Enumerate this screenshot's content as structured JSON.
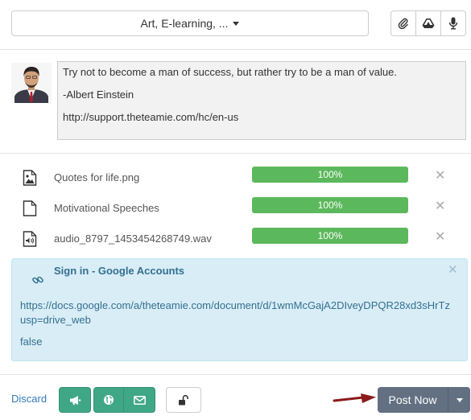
{
  "header": {
    "group_select": "Art, E-learning, ...",
    "attach_icons": [
      "paperclip-icon",
      "google-drive-icon",
      "microphone-icon"
    ]
  },
  "composer": {
    "lines": [
      "Try not to become a man of success, but rather try to be a man of value.",
      "-Albert Einstein",
      "http://support.theteamie.com/hc/en-us"
    ]
  },
  "attachments": [
    {
      "name": "Quotes for life.png",
      "icon": "image-file-icon",
      "progress_label": "100%",
      "progress": 1.0
    },
    {
      "name": "Motivational Speeches",
      "icon": "document-file-icon",
      "progress_label": "100%",
      "progress": 1.0
    },
    {
      "name": "audio_8797_1453454268749.wav",
      "icon": "audio-file-icon",
      "progress_label": "100%",
      "progress": 1.0
    }
  ],
  "link_preview": {
    "title": "Sign in - Google Accounts",
    "url_line1": "https://docs.google.com/a/theteamie.com/document/d/1wmMcGajA2DIveyDPQR28xd3sHrTz",
    "url_line2": "usp=drive_web",
    "description": "false"
  },
  "footer": {
    "discard": "Discard",
    "post_now": "Post Now"
  },
  "colors": {
    "progress_green": "#5cb85c",
    "action_green": "#3fa786",
    "post_button": "#627082",
    "link_preview_bg": "#d9edf7",
    "arrow": "#8b1a1a"
  }
}
